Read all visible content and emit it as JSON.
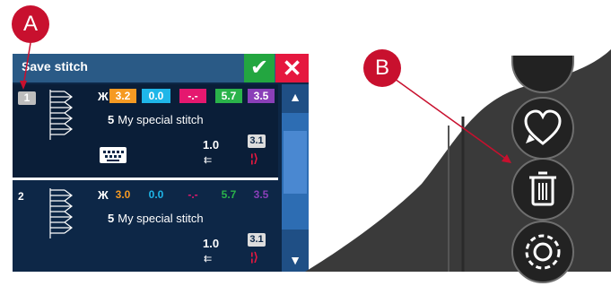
{
  "callouts": {
    "a": "A",
    "b": "B"
  },
  "dialog": {
    "title": "Save stitch",
    "ok_symbol": "✔",
    "close_symbol": "✕",
    "scroll_up": "▲",
    "scroll_down": "▼"
  },
  "rows": [
    {
      "number": "1",
      "params": [
        "3.2",
        "0.0",
        "-.-",
        "5.7",
        "3.5"
      ],
      "stitch_count": "5",
      "name": "My special stitch",
      "length": "1.0",
      "width_badge": "3.1"
    },
    {
      "number": "2",
      "params": [
        "3.0",
        "0.0",
        "-.-",
        "5.7",
        "3.5"
      ],
      "stitch_count": "5",
      "name": "My special stitch",
      "length": "1.0",
      "width_badge": "3.1"
    }
  ],
  "param_colors": [
    "#f59a23",
    "#1fb6e8",
    "#e5186f",
    "#2ab34a",
    "#8a3fb8"
  ],
  "icons": {
    "machine_buttons": [
      "heart-icon",
      "trash-icon",
      "gear-icon"
    ]
  }
}
